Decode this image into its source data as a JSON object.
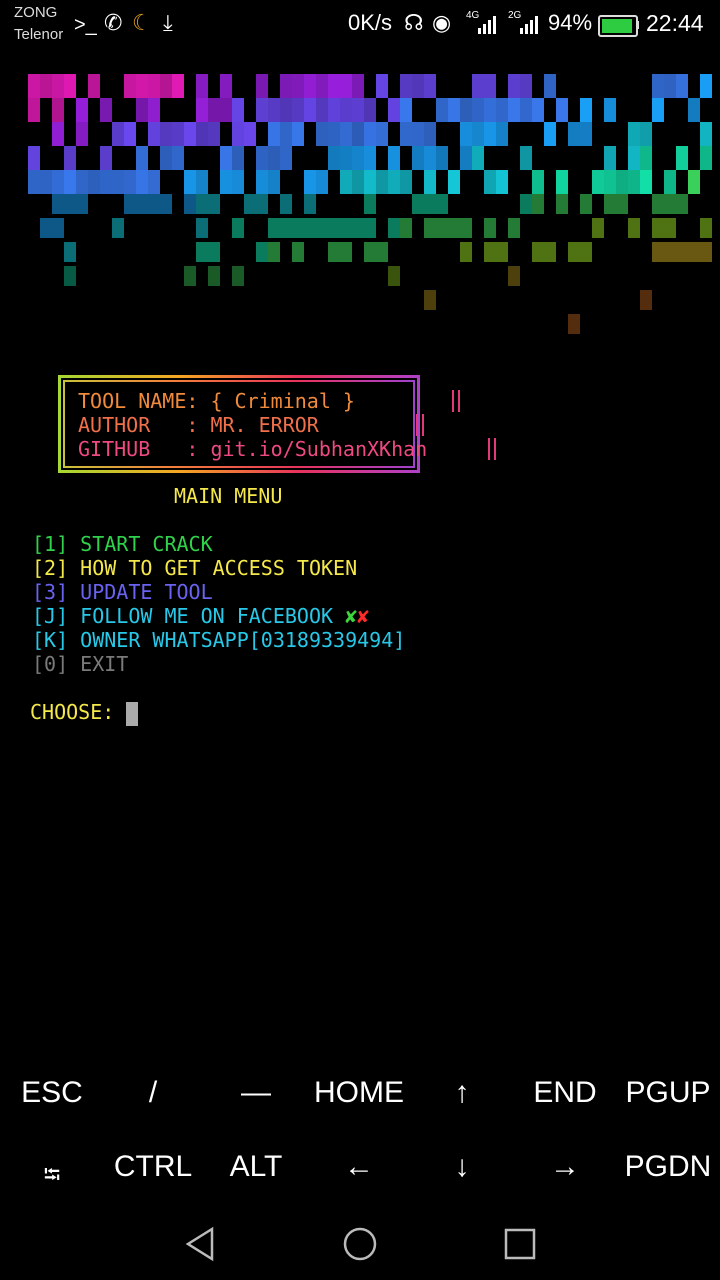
{
  "status_bar": {
    "carrier_1": "ZONG",
    "carrier_2": "Telenor",
    "net_speed": "0K/s",
    "net_type_1": "4G",
    "net_type_2": "2G",
    "battery_pct": "94%",
    "battery_level": 0.94,
    "time": "22:44",
    "icons": [
      "terminal-icon",
      "call-icon",
      "moon-icon",
      "download-icon",
      "headphones-icon",
      "eye-icon",
      "signal-icon",
      "battery-icon"
    ]
  },
  "banner": {
    "colors": [
      "#e41ab8",
      "#9a20e0",
      "#6a48f0",
      "#3a7af0",
      "#1aa0f8",
      "#14c8d8",
      "#12e0a8",
      "#40e060",
      "#90d020",
      "#c0a020",
      "#d07020"
    ]
  },
  "info_box": {
    "tool_name": "TOOL NAME: { Criminal }",
    "author": "AUTHOR   : MR. ERROR",
    "github": "GITHUB   : git.io/SubhanXKhan"
  },
  "main_menu_title": "MAIN MENU",
  "menu": [
    {
      "key": "[1]",
      "label": "START CRACK",
      "color": "#2fd24a"
    },
    {
      "key": "[2]",
      "label": "HOW TO GET ACCESS TOKEN",
      "color": "#f5e84a"
    },
    {
      "key": "[3]",
      "label": "UPDATE TOOL",
      "color": "#6a62f0"
    },
    {
      "key": "[J]",
      "label": "FOLLOW ME ON FACEBOOK",
      "color": "#28c9e8"
    },
    {
      "key": "[K]",
      "label": "OWNER WHATSAPP[03189339494]",
      "color": "#28c9e8"
    },
    {
      "key": "[0]",
      "label": "EXIT",
      "color": "#7a7a7a"
    }
  ],
  "facebook_marks": {
    "check": "✘",
    "cross": "✘"
  },
  "prompt": "CHOOSE:",
  "extra_keys": {
    "row1": [
      "ESC",
      "/",
      "—",
      "HOME",
      "↑",
      "END",
      "PGUP"
    ],
    "row2": [
      "⭾",
      "CTRL",
      "ALT",
      "←",
      "↓",
      "→",
      "PGDN"
    ]
  },
  "nav_icons": [
    "back-icon",
    "home-icon",
    "recents-icon"
  ]
}
